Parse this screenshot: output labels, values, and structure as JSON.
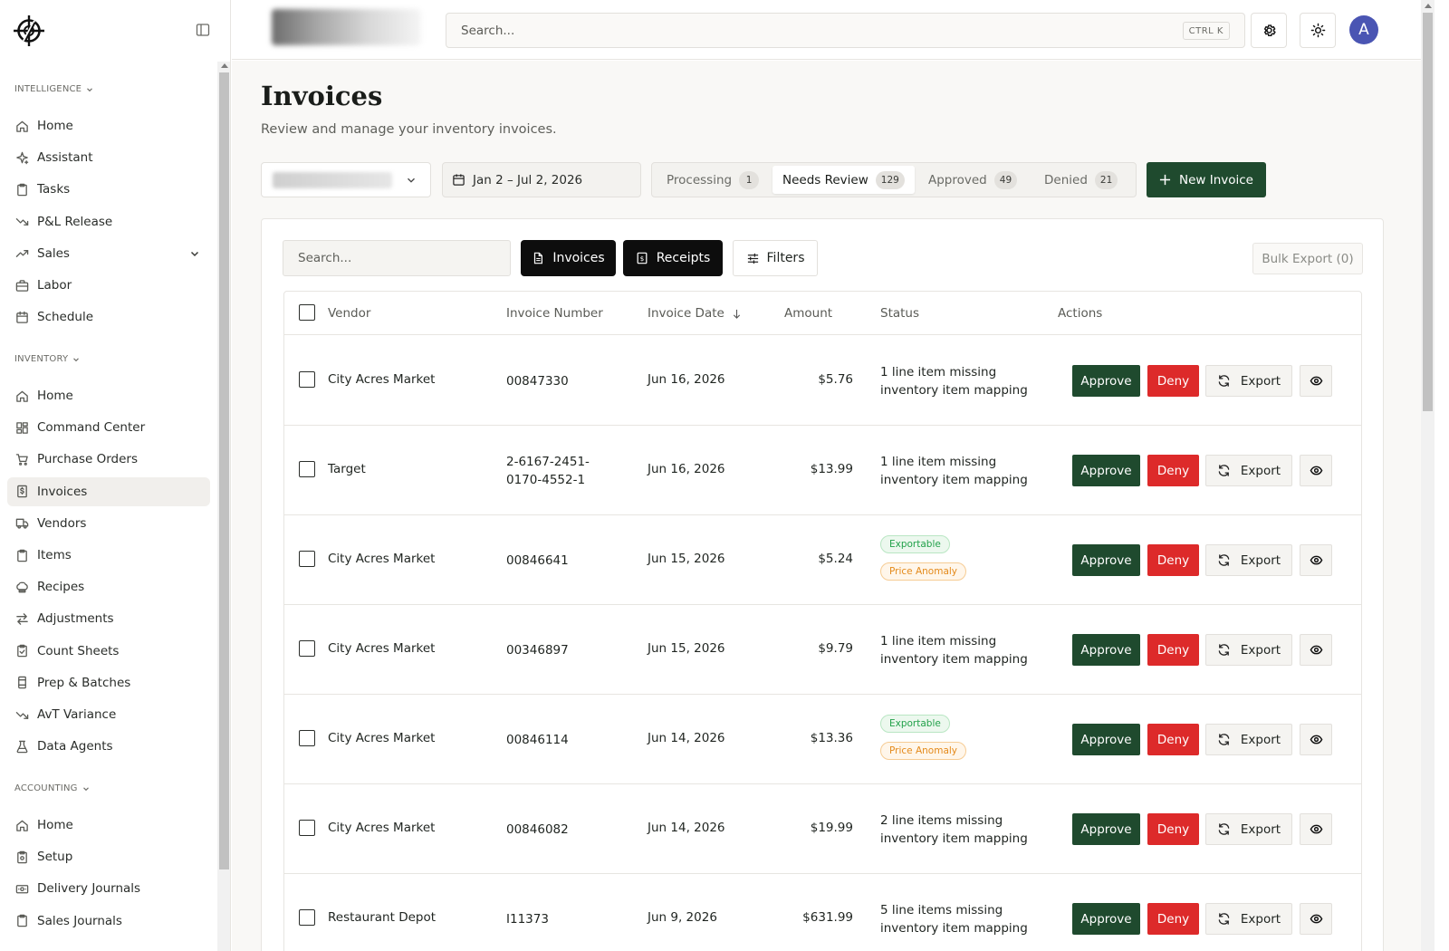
{
  "sidebar": {
    "sections": [
      {
        "title": "INTELLIGENCE",
        "items": [
          {
            "label": "Home",
            "icon": "home-icon"
          },
          {
            "label": "Assistant",
            "icon": "sparkle-icon"
          },
          {
            "label": "Tasks",
            "icon": "clipboard-icon"
          },
          {
            "label": "P&L Release",
            "icon": "trend-down-icon"
          },
          {
            "label": "Sales",
            "icon": "trend-up-icon"
          },
          {
            "label": "Labor",
            "icon": "briefcase-icon"
          },
          {
            "label": "Schedule",
            "icon": "calendar-icon"
          }
        ]
      },
      {
        "title": "INVENTORY",
        "items": [
          {
            "label": "Home",
            "icon": "home-icon"
          },
          {
            "label": "Command Center",
            "icon": "dashboard-icon"
          },
          {
            "label": "Purchase Orders",
            "icon": "cart-icon"
          },
          {
            "label": "Invoices",
            "icon": "invoice-icon",
            "active": true
          },
          {
            "label": "Vendors",
            "icon": "truck-icon"
          },
          {
            "label": "Items",
            "icon": "clipboard-icon"
          },
          {
            "label": "Recipes",
            "icon": "chef-hat-icon"
          },
          {
            "label": "Adjustments",
            "icon": "arrows-icon"
          },
          {
            "label": "Count Sheets",
            "icon": "clipboard-check-icon"
          },
          {
            "label": "Prep & Batches",
            "icon": "container-icon"
          },
          {
            "label": "AvT Variance",
            "icon": "trend-down-icon"
          },
          {
            "label": "Data Agents",
            "icon": "flask-icon"
          }
        ]
      },
      {
        "title": "ACCOUNTING",
        "items": [
          {
            "label": "Home",
            "icon": "home-icon"
          },
          {
            "label": "Setup",
            "icon": "setup-icon"
          },
          {
            "label": "Delivery Journals",
            "icon": "banknote-icon"
          },
          {
            "label": "Sales Journals",
            "icon": "clipboard-icon"
          }
        ]
      }
    ]
  },
  "topbar": {
    "search_placeholder": "Search...",
    "shortcut": "CTRL K",
    "avatar_initial": "A"
  },
  "page": {
    "title": "Invoices",
    "subtitle": "Review and manage your inventory invoices.",
    "date_range": "Jan 2 – Jul 2, 2026",
    "status_tabs": [
      {
        "label": "Processing",
        "count": "1"
      },
      {
        "label": "Needs Review",
        "count": "129",
        "active": true
      },
      {
        "label": "Approved",
        "count": "49"
      },
      {
        "label": "Denied",
        "count": "21"
      }
    ],
    "new_invoice_label": "New Invoice"
  },
  "toolbar": {
    "search_placeholder": "Search...",
    "invoices_label": "Invoices",
    "receipts_label": "Receipts",
    "filters_label": "Filters",
    "bulk_export_label": "Bulk Export (0)"
  },
  "table": {
    "columns": {
      "vendor": "Vendor",
      "invoice_number": "Invoice Number",
      "invoice_date": "Invoice Date",
      "amount": "Amount",
      "status": "Status",
      "actions": "Actions"
    },
    "action_labels": {
      "approve": "Approve",
      "deny": "Deny",
      "export": "Export"
    },
    "rows": [
      {
        "vendor": "City Acres Market",
        "number": "00847330",
        "date": "Jun 16, 2026",
        "amount": "$5.76",
        "status_text": "1 line item missing inventory item mapping"
      },
      {
        "vendor": "Target",
        "number": "2-6167-2451-0170-4552-1",
        "date": "Jun 16, 2026",
        "amount": "$13.99",
        "status_text": "1 line item missing inventory item mapping"
      },
      {
        "vendor": "City Acres Market",
        "number": "00846641",
        "date": "Jun 15, 2026",
        "amount": "$5.24",
        "badges": [
          "Exportable",
          "Price Anomaly"
        ]
      },
      {
        "vendor": "City Acres Market",
        "number": "00346897",
        "date": "Jun 15, 2026",
        "amount": "$9.79",
        "status_text": "1 line item missing inventory item mapping"
      },
      {
        "vendor": "City Acres Market",
        "number": "00846114",
        "date": "Jun 14, 2026",
        "amount": "$13.36",
        "badges": [
          "Exportable",
          "Price Anomaly"
        ]
      },
      {
        "vendor": "City Acres Market",
        "number": "00846082",
        "date": "Jun 14, 2026",
        "amount": "$19.99",
        "status_text": "2 line items missing inventory item mapping"
      },
      {
        "vendor": "Restaurant Depot",
        "number": "I11373",
        "date": "Jun 9, 2026",
        "amount": "$631.99",
        "status_text": "5 line items missing inventory item mapping"
      }
    ]
  },
  "colors": {
    "primary_green": "#1f4a2e",
    "deny_red": "#dd2a2a",
    "avatar_blue": "#4a55b3",
    "exportable_green": "#22a14a",
    "anomaly_orange": "#e48a1b"
  }
}
